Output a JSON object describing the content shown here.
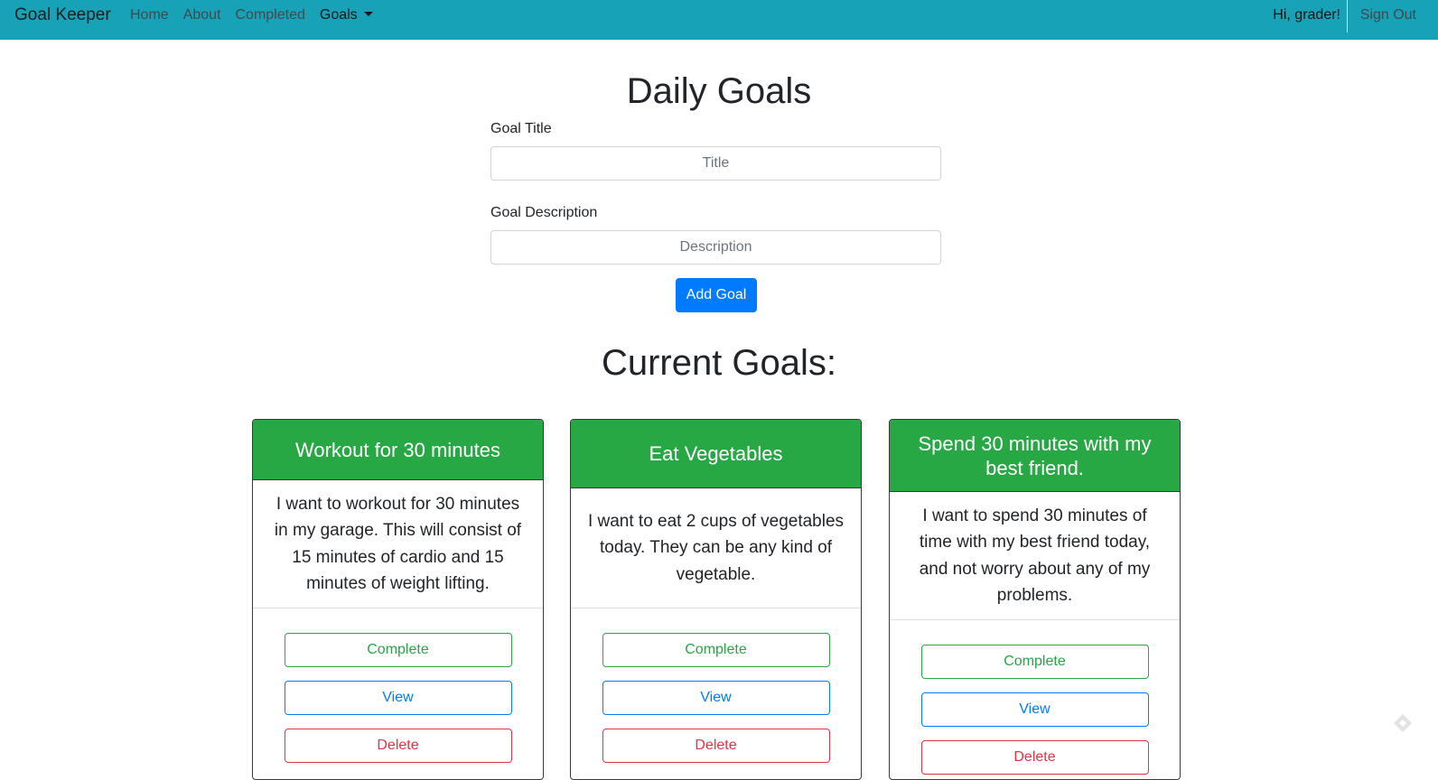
{
  "navbar": {
    "brand": "Goal Keeper",
    "links": [
      "Home",
      "About",
      "Completed",
      "Goals"
    ],
    "greeting": "Hi, grader!",
    "signout": "Sign Out"
  },
  "form": {
    "heading": "Daily Goals",
    "title_label": "Goal Title",
    "title_placeholder": "Title",
    "description_label": "Goal Description",
    "description_placeholder": "Description",
    "submit_label": "Add Goal"
  },
  "goals": {
    "heading": "Current Goals:",
    "items": [
      {
        "title": "Workout for 30 minutes",
        "description": "I want to workout for 30 minutes in my garage. This will consist of 15 minutes of cardio and 15 minutes of weight lifting."
      },
      {
        "title": "Eat Vegetables",
        "description": "I want to eat 2 cups of vegetables today. They can be any kind of vegetable."
      },
      {
        "title": "Spend 30 minutes with my best friend.",
        "description": "I want to spend 30 minutes of time with my best friend today, and not worry about any of my problems."
      }
    ],
    "complete_label": "Complete",
    "view_label": "View",
    "delete_label": "Delete"
  },
  "colors": {
    "navbar": "#17a2b8",
    "card_header": "#28a745",
    "primary": "#007bff",
    "danger": "#dc3545"
  },
  "icons": {
    "corner": "diamond-tag-icon"
  }
}
